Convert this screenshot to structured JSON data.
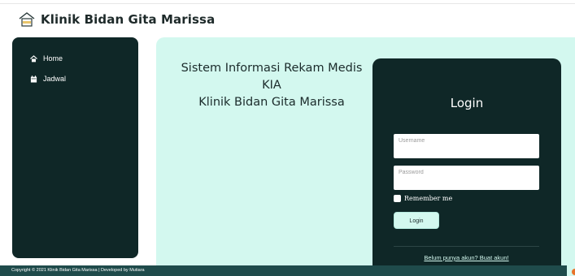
{
  "brand": {
    "name": "Klinik Bidan Gita Marissa",
    "logo_icon": "house-logo-icon"
  },
  "sidebar": {
    "items": [
      {
        "label": "Home",
        "icon": "home-icon"
      },
      {
        "label": "Jadwal",
        "icon": "calendar-icon"
      }
    ]
  },
  "hero": {
    "line1": "Sistem Informasi Rekam Medis",
    "line2": "KIA",
    "line3": "Klinik Bidan Gita Marissa"
  },
  "login": {
    "title": "Login",
    "username_placeholder": "Username",
    "username_value": "",
    "password_placeholder": "Password",
    "password_value": "",
    "remember_label": "Remember me",
    "remember_checked": false,
    "button_label": "Login",
    "register_link": "Belum punya akun? Buat akun!"
  },
  "footer": {
    "text": "Copyright © 2021 Klinik Bidan Gita Marissa | Developed by Mutiara"
  },
  "colors": {
    "dark": "#0f2727",
    "mint": "#d3f8ef",
    "footer": "#1f4b4b"
  }
}
